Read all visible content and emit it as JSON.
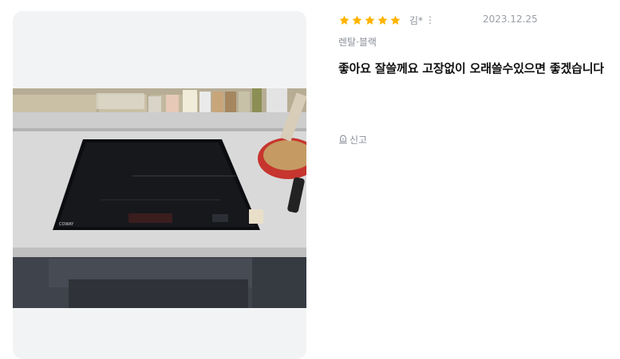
{
  "review": {
    "rating": 5,
    "rating_max": 5,
    "author": "김*",
    "more_icon": "⋮",
    "date": "2023.12.25",
    "option": "렌탈·블랙",
    "text": "좋아요 잘쓸께요 고장없이 오래쓸수있으면 좋겠습니다",
    "report_label": "신고"
  },
  "photo": {
    "brand": "COWAY"
  },
  "colors": {
    "star": "#FFB400",
    "muted": "#8A8F99",
    "text": "#111111",
    "photo_bg": "#F2F3F5"
  }
}
